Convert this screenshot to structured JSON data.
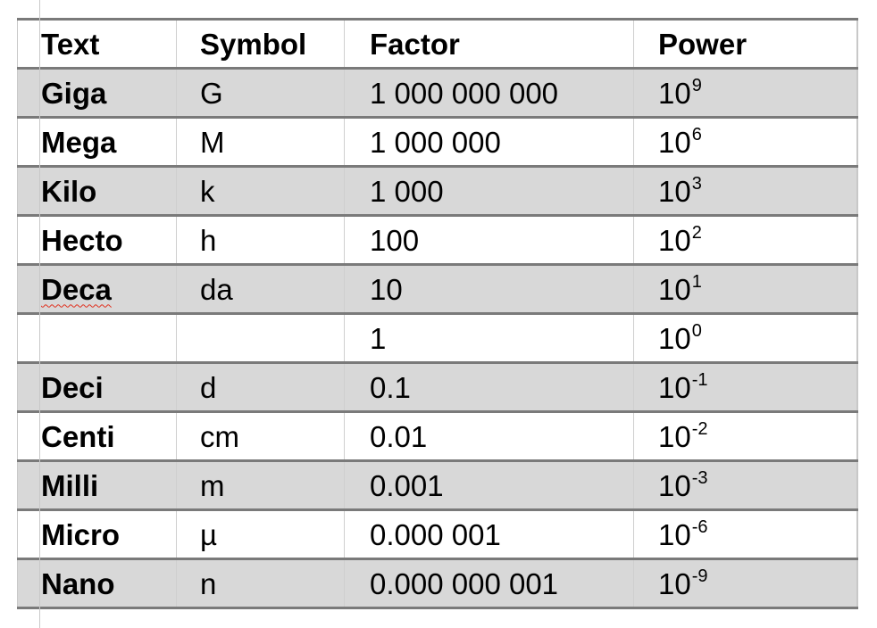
{
  "table": {
    "headers": [
      "Text",
      "Symbol",
      "Factor",
      "Power"
    ],
    "rows": [
      {
        "text": "Giga",
        "symbol": "G",
        "factor": "1 000 000 000",
        "power_base": "10",
        "power_exp": "9",
        "shaded": true,
        "spell_error": false
      },
      {
        "text": "Mega",
        "symbol": "M",
        "factor": "1 000 000",
        "power_base": "10",
        "power_exp": "6",
        "shaded": false,
        "spell_error": false
      },
      {
        "text": "Kilo",
        "symbol": "k",
        "factor": "1 000",
        "power_base": "10",
        "power_exp": "3",
        "shaded": true,
        "spell_error": false
      },
      {
        "text": "Hecto",
        "symbol": "h",
        "factor": "100",
        "power_base": "10",
        "power_exp": "2",
        "shaded": false,
        "spell_error": false
      },
      {
        "text": "Deca",
        "symbol": "da",
        "factor": "10",
        "power_base": "10",
        "power_exp": "1",
        "shaded": true,
        "spell_error": true
      },
      {
        "text": "",
        "symbol": "",
        "factor": "1",
        "power_base": "10",
        "power_exp": "0",
        "shaded": false,
        "spell_error": false
      },
      {
        "text": "Deci",
        "symbol": "d",
        "factor": "0.1",
        "power_base": "10",
        "power_exp": "-1",
        "shaded": true,
        "spell_error": false
      },
      {
        "text": "Centi",
        "symbol": "cm",
        "factor": "0.01",
        "power_base": "10",
        "power_exp": "-2",
        "shaded": false,
        "spell_error": false
      },
      {
        "text": "Milli",
        "symbol": "m",
        "factor": "0.001",
        "power_base": "10",
        "power_exp": "-3",
        "shaded": true,
        "spell_error": false
      },
      {
        "text": "Micro",
        "symbol": "µ",
        "factor": "0.000 001",
        "power_base": "10",
        "power_exp": "-6",
        "shaded": false,
        "spell_error": false
      },
      {
        "text": "Nano",
        "symbol": "n",
        "factor": "0.000 000 001",
        "power_base": "10",
        "power_exp": "-9",
        "shaded": true,
        "spell_error": false
      }
    ]
  },
  "colors": {
    "shaded_row": "#d8d8d8",
    "row_border": "#7a7a7a",
    "cell_divider": "#cfcfcf",
    "spell_underline": "#e0301e"
  }
}
